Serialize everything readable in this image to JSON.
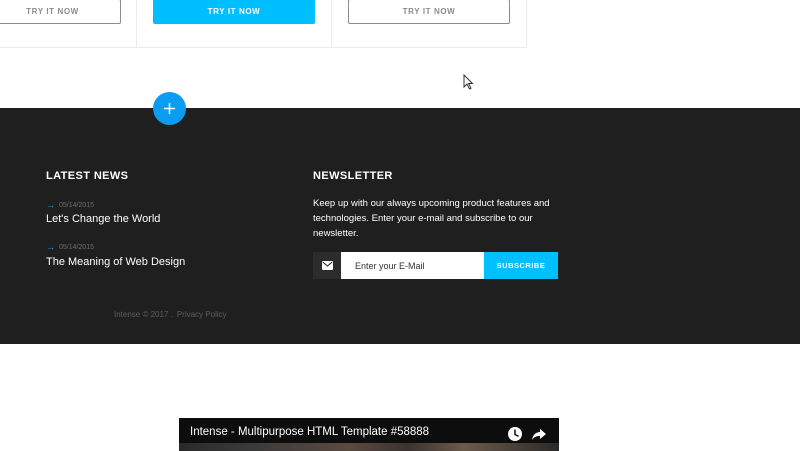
{
  "pricing": {
    "buttons": [
      "TRY IT NOW",
      "TRY IT NOW",
      "TRY IT NOW"
    ]
  },
  "footer": {
    "latest_news": {
      "heading": "LATEST NEWS",
      "items": [
        {
          "date": "05/14/2015",
          "title": "Let's Change the World"
        },
        {
          "date": "05/14/2015",
          "title": "The Meaning of Web Design"
        }
      ]
    },
    "newsletter": {
      "heading": "NEWSLETTER",
      "text": "Keep up with our always upcoming product features and technologies. Enter your e-mail and subscribe to our newsletter.",
      "input_placeholder": "Enter your E-Mail",
      "submit_label": "SUBSCRIBE"
    },
    "copyright": "Intense © 2017 .",
    "privacy_link": "Privacy Policy"
  },
  "video": {
    "title": "Intense - Multipurpose HTML Template #58888"
  },
  "icons": {
    "plus": "plus-icon",
    "mail": "mail-icon",
    "arrow": "arrow-right-icon",
    "clock": "clock-icon",
    "share": "share-icon",
    "cursor": "mouse-cursor-icon"
  },
  "colors": {
    "accent": "#00bfff",
    "footer_bg": "#1f1f1f",
    "plus_bg": "#0a9cf0"
  }
}
